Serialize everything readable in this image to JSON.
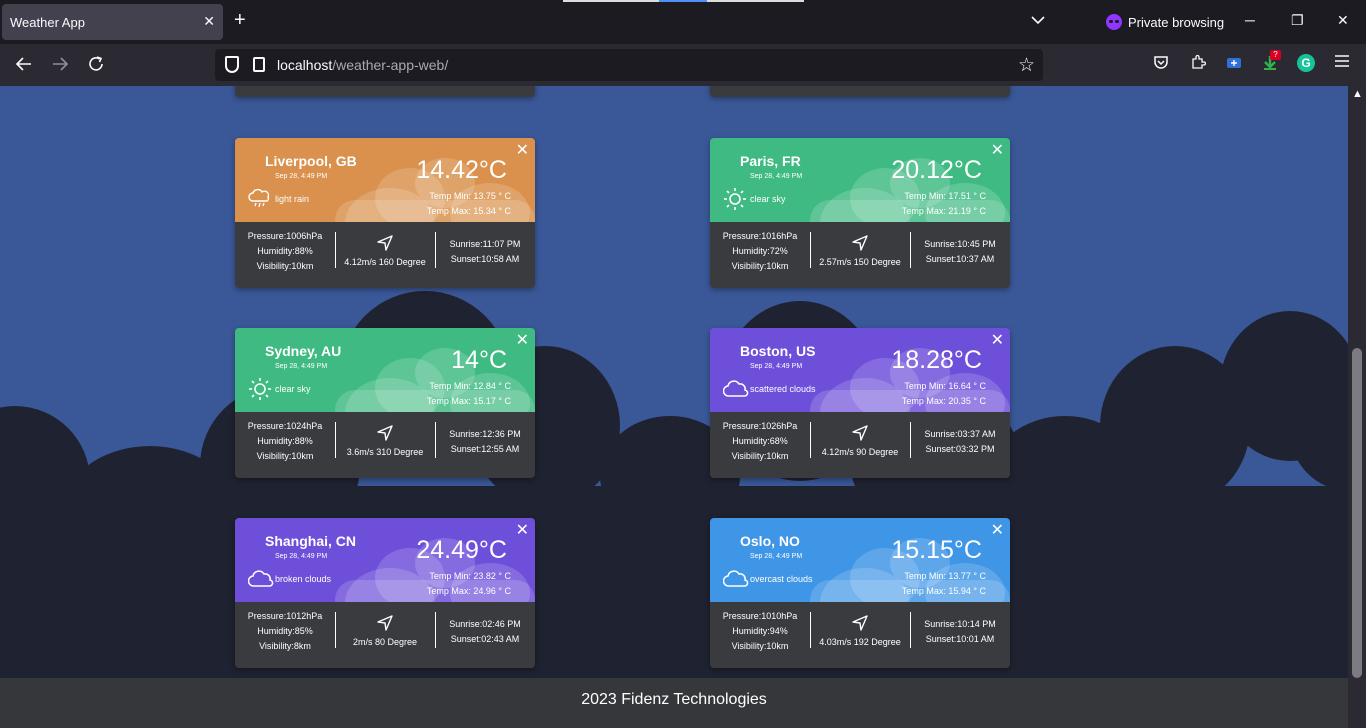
{
  "browser": {
    "tab_title": "Weather App",
    "url_host": "localhost",
    "url_path": "/weather-app-web/",
    "private_label": "Private browsing",
    "extension_badge": "?"
  },
  "cards": [
    {
      "city": "Liverpool, GB",
      "date": "Sep 28, 4:49 PM",
      "temp": "14.42°C",
      "temp_min": "Temp Min: 13.75 ° C",
      "temp_max": "Temp Max: 15.34 ° C",
      "description": "light rain",
      "icon": "rain-cloud-icon",
      "pressure": "Pressure:1006hPa",
      "humidity": "Humidity:88%",
      "visibility": "Visibility:10km",
      "wind": "4.12m/s 160 Degree",
      "sunrise": "Sunrise:11:07 PM",
      "sunset": "Sunset:10:58 AM",
      "color": "#d9914d"
    },
    {
      "city": "Paris, FR",
      "date": "Sep 28, 4:49 PM",
      "temp": "20.12°C",
      "temp_min": "Temp Min: 17.51 ° C",
      "temp_max": "Temp Max: 21.19 ° C",
      "description": "clear sky",
      "icon": "sun-icon",
      "pressure": "Pressure:1016hPa",
      "humidity": "Humidity:72%",
      "visibility": "Visibility:10km",
      "wind": "2.57m/s 150 Degree",
      "sunrise": "Sunrise:10:45 PM",
      "sunset": "Sunset:10:37 AM",
      "color": "#3fba82"
    },
    {
      "city": "Sydney, AU",
      "date": "Sep 28, 4:49 PM",
      "temp": "14°C",
      "temp_min": "Temp Min: 12.84 ° C",
      "temp_max": "Temp Max: 15.17 ° C",
      "description": "clear sky",
      "icon": "sun-icon",
      "pressure": "Pressure:1024hPa",
      "humidity": "Humidity:88%",
      "visibility": "Visibility:10km",
      "wind": "3.6m/s 310 Degree",
      "sunrise": "Sunrise:12:36 PM",
      "sunset": "Sunset:12:55 AM",
      "color": "#3fba82"
    },
    {
      "city": "Boston, US",
      "date": "Sep 28, 4:49 PM",
      "temp": "18.28°C",
      "temp_min": "Temp Min: 16.64 ° C",
      "temp_max": "Temp Max: 20.35 ° C",
      "description": "scattered clouds",
      "icon": "cloud-icon",
      "pressure": "Pressure:1026hPa",
      "humidity": "Humidity:68%",
      "visibility": "Visibility:10km",
      "wind": "4.12m/s 90 Degree",
      "sunrise": "Sunrise:03:37 AM",
      "sunset": "Sunset:03:32 PM",
      "color": "#6e4fd9"
    },
    {
      "city": "Shanghai, CN",
      "date": "Sep 28, 4:49 PM",
      "temp": "24.49°C",
      "temp_min": "Temp Min: 23.82 ° C",
      "temp_max": "Temp Max: 24.96 ° C",
      "description": "broken clouds",
      "icon": "cloud-icon",
      "pressure": "Pressure:1012hPa",
      "humidity": "Humidity:85%",
      "visibility": "Visibility:8km",
      "wind": "2m/s 80 Degree",
      "sunrise": "Sunrise:02:46 PM",
      "sunset": "Sunset:02:43 AM",
      "color": "#6e4fd9"
    },
    {
      "city": "Oslo, NO",
      "date": "Sep 28, 4:49 PM",
      "temp": "15.15°C",
      "temp_min": "Temp Min: 13.77 ° C",
      "temp_max": "Temp Max: 15.94 ° C",
      "description": "overcast clouds",
      "icon": "cloud-icon",
      "pressure": "Pressure:1010hPa",
      "humidity": "Humidity:94%",
      "visibility": "Visibility:10km",
      "wind": "4.03m/s 192 Degree",
      "sunrise": "Sunrise:10:14 PM",
      "sunset": "Sunset:10:01 AM",
      "color": "#3f95e6"
    }
  ],
  "footer": {
    "text": "2023 Fidenz Technologies"
  }
}
